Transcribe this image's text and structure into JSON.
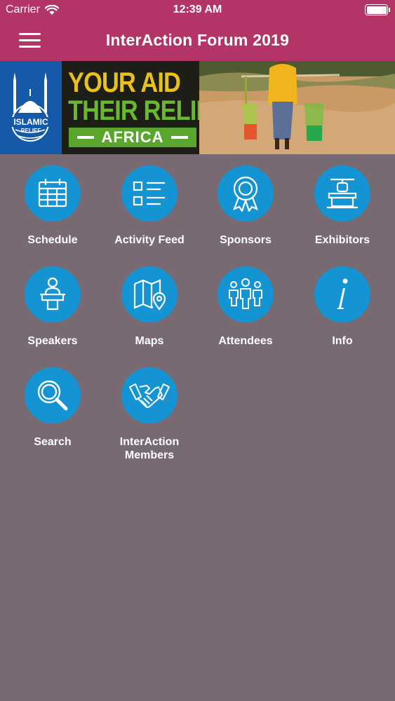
{
  "status_bar": {
    "carrier": "Carrier",
    "time": "12:39 AM"
  },
  "nav": {
    "title": "InterAction Forum 2019"
  },
  "banner": {
    "logo_text_1": "ISLAMIC",
    "logo_text_2": "RELIEF",
    "line1": "YOUR AID",
    "line2": "THEIR RELIEF",
    "region": "AFRICA"
  },
  "tiles": [
    {
      "label": "Schedule",
      "icon": "calendar-icon"
    },
    {
      "label": "Activity Feed",
      "icon": "list-icon"
    },
    {
      "label": "Sponsors",
      "icon": "award-ribbon-icon"
    },
    {
      "label": "Exhibitors",
      "icon": "booth-icon"
    },
    {
      "label": "Speakers",
      "icon": "podium-icon"
    },
    {
      "label": "Maps",
      "icon": "map-icon"
    },
    {
      "label": "Attendees",
      "icon": "people-icon"
    },
    {
      "label": "Info",
      "icon": "info-icon"
    },
    {
      "label": "Search",
      "icon": "search-icon"
    },
    {
      "label": "InterAction Members",
      "icon": "handshake-icon"
    }
  ],
  "colors": {
    "header": "#b33466",
    "background": "#776a72",
    "icon_circle": "#1594d3"
  }
}
